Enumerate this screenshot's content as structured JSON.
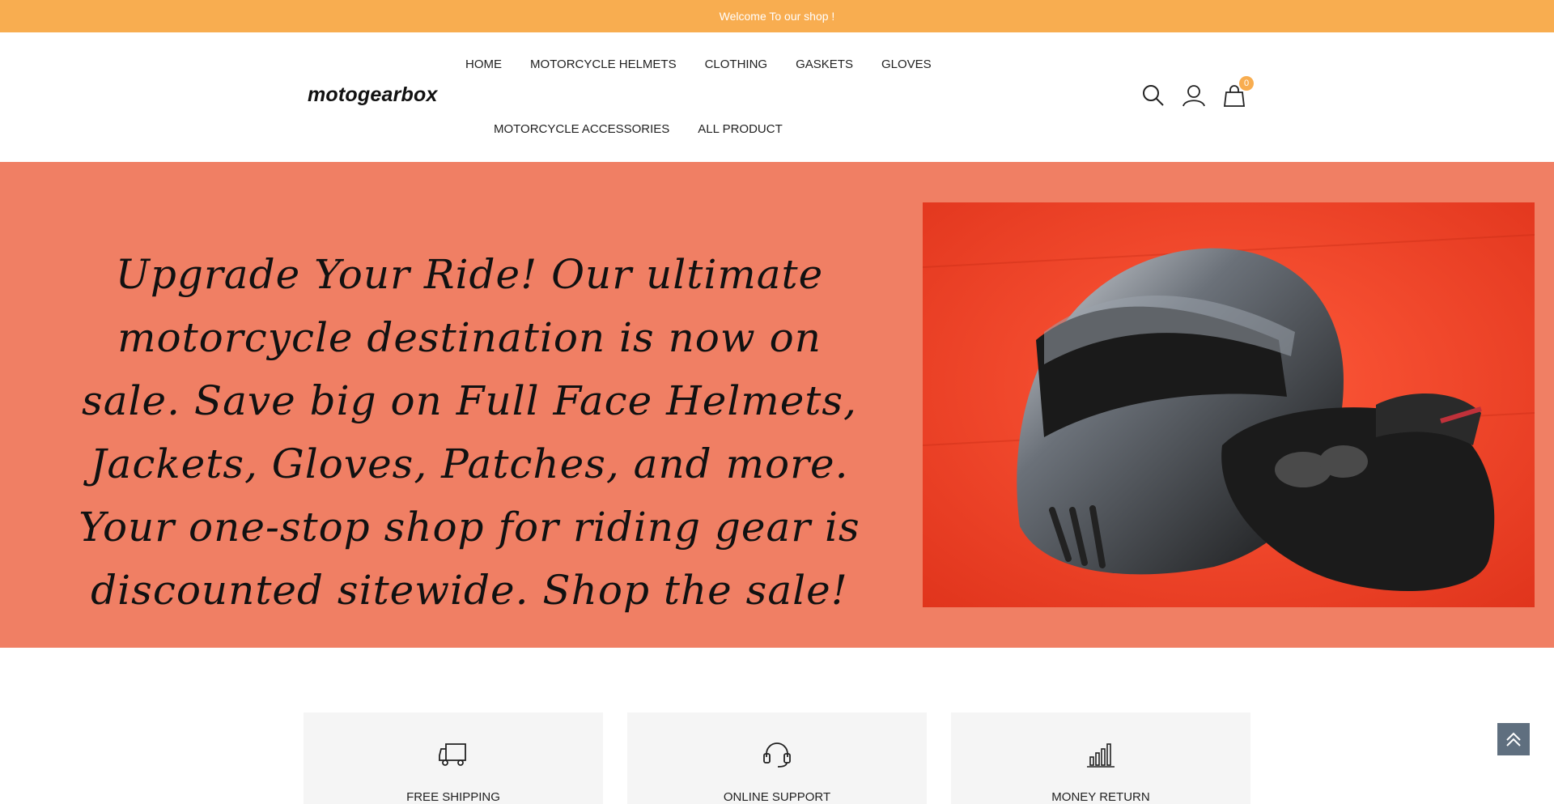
{
  "announcement": "Welcome To our shop !",
  "logo": "motogearbox",
  "nav": {
    "row1": [
      "HOME",
      "MOTORCYCLE HELMETS",
      "CLOTHING",
      "GASKETS",
      "GLOVES"
    ],
    "row2": [
      "MOTORCYCLE ACCESSORIES",
      "ALL PRODUCT"
    ]
  },
  "header_icons": {
    "search": "search-icon",
    "account": "user-icon",
    "cart": "cart-icon",
    "cart_count": "0"
  },
  "hero": {
    "text": "Upgrade Your Ride! Our ultimate motorcycle destination is now on sale. Save big on Full Face Helmets, Jackets, Gloves, Patches, and more. Your one-stop shop for riding gear is discounted sitewide. Shop the sale!"
  },
  "features": [
    {
      "label": "FREE SHIPPING",
      "icon": "truck-icon"
    },
    {
      "label": "ONLINE SUPPORT",
      "icon": "headset-icon"
    },
    {
      "label": "MONEY RETURN",
      "icon": "chart-icon"
    }
  ],
  "colors": {
    "accent": "#f8ad50",
    "hero_bg": "#f07f64",
    "scroll_btn": "#5f6f7f"
  }
}
